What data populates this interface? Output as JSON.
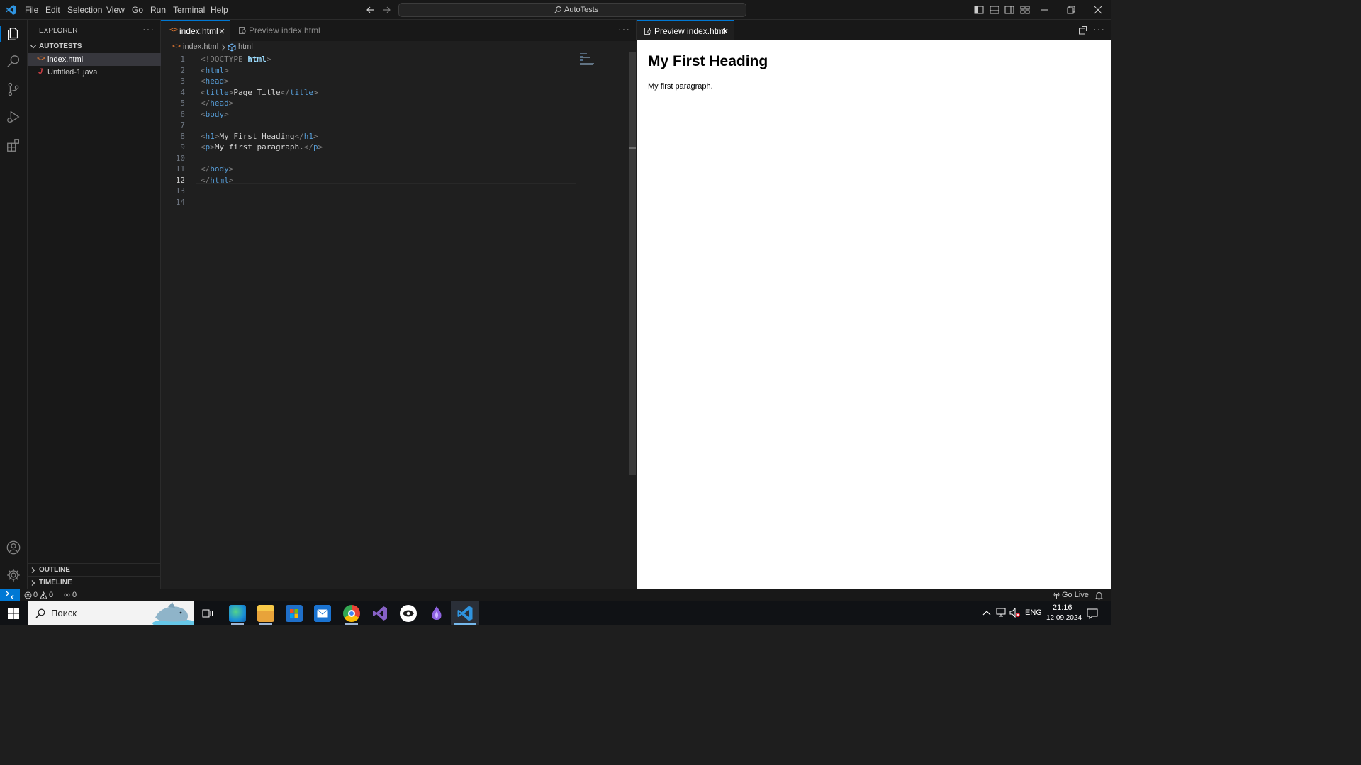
{
  "titlebar": {
    "menu": [
      "File",
      "Edit",
      "Selection",
      "View",
      "Go",
      "Run",
      "Terminal",
      "Help"
    ],
    "search_text": "AutoTests"
  },
  "sidebar": {
    "title": "EXPLORER",
    "folder": "AUTOTESTS",
    "files": [
      {
        "name": "index.html",
        "icon": "html-file-icon"
      },
      {
        "name": "Untitled-1.java",
        "icon": "java-file-icon"
      }
    ],
    "outline": "OUTLINE",
    "timeline": "TIMELINE"
  },
  "editor": {
    "tabs": [
      {
        "label": "index.html",
        "active": true
      },
      {
        "label": "Preview index.html",
        "active": false
      }
    ],
    "breadcrumb": [
      "index.html",
      "html"
    ],
    "line_numbers": [
      "1",
      "2",
      "3",
      "4",
      "5",
      "6",
      "7",
      "8",
      "9",
      "10",
      "11",
      "12",
      "13",
      "14"
    ],
    "current_line": "12"
  },
  "code": {
    "l1_a": "<!DOCTYPE ",
    "l1_b": "html",
    "l1_c": ">",
    "l2_a": "<",
    "l2_b": "html",
    "l2_c": ">",
    "l3_a": "<",
    "l3_b": "head",
    "l3_c": ">",
    "l4_a": "<",
    "l4_b": "title",
    "l4_c": ">",
    "l4_d": "Page Title",
    "l4_e": "</",
    "l4_f": "title",
    "l4_g": ">",
    "l5_a": "</",
    "l5_b": "head",
    "l5_c": ">",
    "l6_a": "<",
    "l6_b": "body",
    "l6_c": ">",
    "l8_a": "<",
    "l8_b": "h1",
    "l8_c": ">",
    "l8_d": "My First Heading",
    "l8_e": "</",
    "l8_f": "h1",
    "l8_g": ">",
    "l9_a": "<",
    "l9_b": "p",
    "l9_c": ">",
    "l9_d": "My first paragraph.",
    "l9_e": "</",
    "l9_f": "p",
    "l9_g": ">",
    "l11_a": "</",
    "l11_b": "body",
    "l11_c": ">",
    "l12_a": "</",
    "l12_b": "html",
    "l12_c": ">"
  },
  "preview": {
    "tab_label": "Preview index.html",
    "heading": "My First Heading",
    "paragraph": "My first paragraph."
  },
  "statusbar": {
    "errors": "0",
    "warnings": "0",
    "ports": "0",
    "go_live": "Go Live"
  },
  "taskbar": {
    "search_placeholder": "Поиск",
    "lang": "ENG",
    "time": "21:16",
    "date": "12.09.2024"
  },
  "colors": {
    "accent": "#0078d4",
    "html_icon": "#e37933",
    "java_icon": "#cc3e44"
  }
}
